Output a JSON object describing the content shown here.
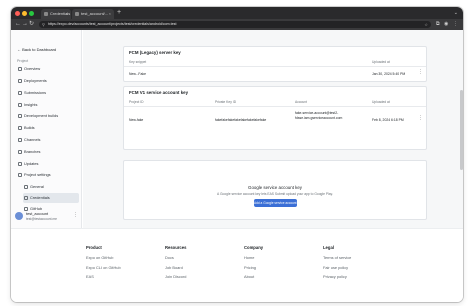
{
  "browser": {
    "tabs": [
      {
        "label": "Credentials"
      },
      {
        "label": "test_account/..."
      }
    ],
    "url": "https://expo.dev/accounts/test_account/projects/test/credentials/android/com.test"
  },
  "sidebar": {
    "back_label": "Back to Dashboard",
    "section_label": "Project",
    "items": [
      {
        "label": "Overview"
      },
      {
        "label": "Deployments"
      },
      {
        "label": "Submissions"
      },
      {
        "label": "Insights"
      },
      {
        "label": "Development builds"
      },
      {
        "label": "Builds"
      },
      {
        "label": "Channels"
      },
      {
        "label": "Branches"
      },
      {
        "label": "Updates"
      },
      {
        "label": "Project settings"
      }
    ],
    "sub_items": [
      {
        "label": "General"
      },
      {
        "label": "Credentials"
      },
      {
        "label": "GitHub"
      }
    ],
    "account": {
      "name": "test_account",
      "email": "test@testaccount.me"
    }
  },
  "fcm_legacy": {
    "title": "FCM (Legacy) server key",
    "headers": {
      "key_snippet": "Key snippet",
      "uploaded_at": "Uploaded at"
    },
    "row": {
      "key_snippet": "New...Fake",
      "uploaded_at": "Jan 30, 2024 5:40 PM"
    }
  },
  "fcm_v1": {
    "title": "FCM V1 service account key",
    "headers": {
      "project_id": "Project ID",
      "private_key_id": "Private Key ID",
      "account": "Account",
      "uploaded_at": "Uploaded at"
    },
    "row": {
      "project_id": "New-fake",
      "private_key_id": "fakefakefakefakefakefakefakefake",
      "account_line1": "fake-service-account@test2-",
      "account_line2": "fdsse.iam.gserviceaccount.com",
      "uploaded_at": "Feb 8, 2024 6:18 PM"
    }
  },
  "google_service": {
    "title": "Google service account key",
    "description": "A Google service account key lets EAS Submit upload your app to Google Play.",
    "button_label": "Add a Google service account key"
  },
  "footer": {
    "columns": [
      {
        "heading": "Product",
        "links": [
          "Expo on GitHub",
          "Expo CLI on GitHub",
          "EAS"
        ]
      },
      {
        "heading": "Resources",
        "links": [
          "Docs",
          "Job Board",
          "Join Discord"
        ]
      },
      {
        "heading": "Company",
        "links": [
          "Home",
          "Pricing",
          "About"
        ]
      },
      {
        "heading": "Legal",
        "links": [
          "Terms of service",
          "Fair use policy",
          "Privacy policy"
        ]
      }
    ]
  }
}
